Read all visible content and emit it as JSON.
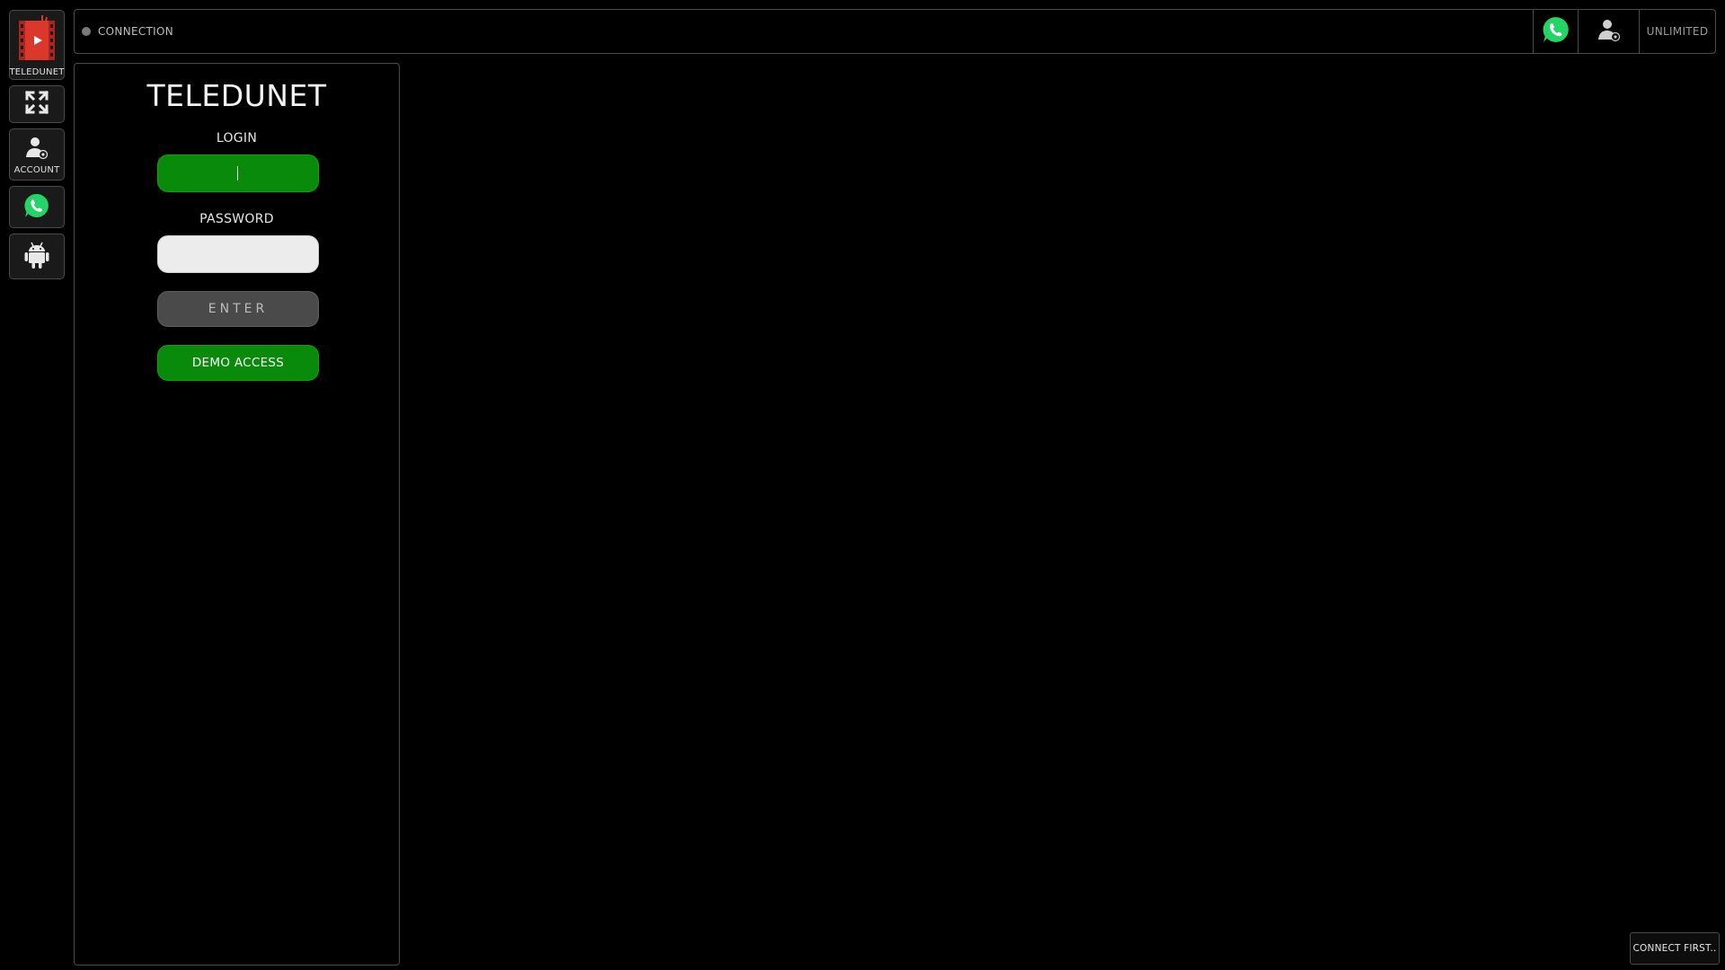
{
  "sidebar": {
    "items": [
      {
        "label": "TELEDUNET",
        "icon": "film-play-icon"
      },
      {
        "label": "",
        "icon": "fullscreen-icon"
      },
      {
        "label": "ACCOUNT",
        "icon": "account-icon"
      },
      {
        "label": "",
        "icon": "whatsapp-icon"
      },
      {
        "label": "",
        "icon": "android-icon"
      }
    ]
  },
  "topbar": {
    "status_label": "CONNECTION",
    "plan_label": "UNLIMITED",
    "icons": [
      "whatsapp-icon",
      "account-icon"
    ]
  },
  "login_panel": {
    "title": "TELEDUNET",
    "login_label": "LOGIN",
    "login_value": "",
    "password_label": "PASSWORD",
    "password_value": "",
    "enter_label": "ENTER",
    "demo_label": "DEMO ACCESS"
  },
  "notice": {
    "text": "CONNECT FIRST.."
  },
  "colors": {
    "accent_green": "#0a8a0a",
    "whatsapp_green": "#25d366",
    "logo_red": "#d9382b",
    "border": "#4a4a4a",
    "background": "#000000"
  }
}
